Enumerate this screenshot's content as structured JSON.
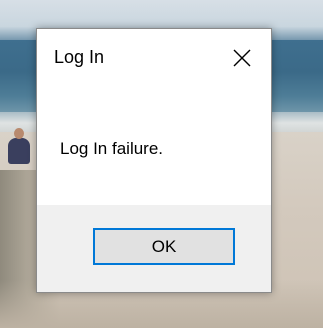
{
  "dialog": {
    "title": "Log In",
    "message": "Log In failure.",
    "ok_label": "OK",
    "close_icon": "close-icon"
  },
  "colors": {
    "dialog_background": "#ffffff",
    "footer_background": "#f0f0f0",
    "button_background": "#e1e1e1",
    "button_focus_border": "#0078d7"
  }
}
